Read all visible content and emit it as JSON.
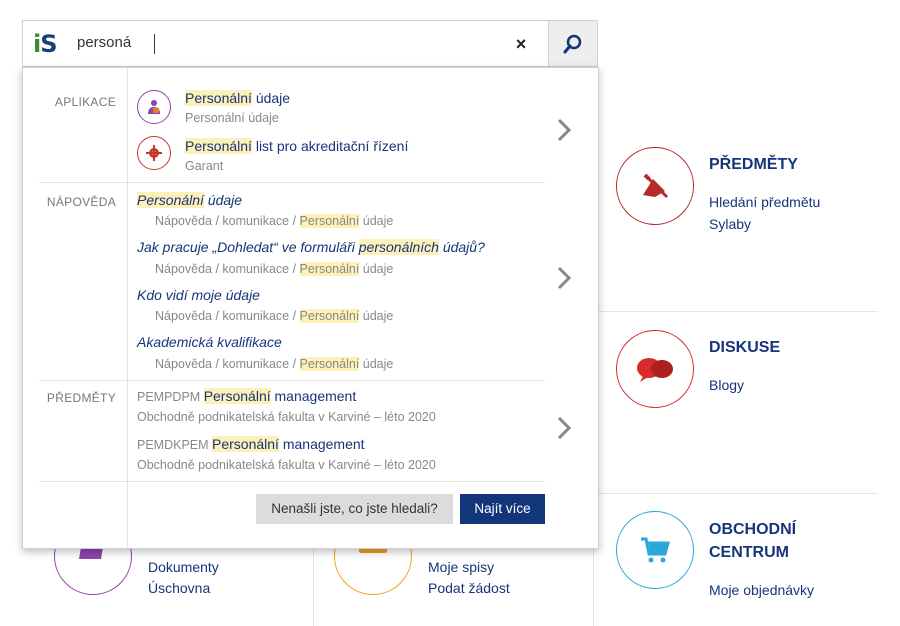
{
  "search": {
    "logo_i": "i",
    "logo_s": "S",
    "value": "personá",
    "clear_label": "×"
  },
  "highlight": "Personální",
  "dropdown": {
    "apps": {
      "label": "APLIKACE",
      "items": [
        {
          "icon": "person-icon",
          "color": "#8e44ad",
          "hl": "Personální",
          "rest": " údaje",
          "sub": "Personální údaje"
        },
        {
          "icon": "gear-icon",
          "color": "#c0392b",
          "hl": "Personální",
          "rest": " list pro akreditační řízení",
          "sub": "Garant"
        }
      ]
    },
    "help": {
      "label": "NÁPOVĚDA",
      "items": [
        {
          "title_pre": "",
          "title_hl": "Personální",
          "title_post": " údaje",
          "path_pre": "Nápověda / komunikace / ",
          "path_hl": "Personální",
          "path_post": " údaje"
        },
        {
          "title_pre": "Jak pracuje „Dohledat“ ve formuláři ",
          "title_hl": "personálních",
          "title_post": " údajů?",
          "path_pre": "Nápověda / komunikace / ",
          "path_hl": "Personální",
          "path_post": " údaje"
        },
        {
          "title_pre": "Kdo vidí moje údaje",
          "title_hl": "",
          "title_post": "",
          "path_pre": "Nápověda / komunikace / ",
          "path_hl": "Personální",
          "path_post": " údaje"
        },
        {
          "title_pre": "Akademická kvalifikace",
          "title_hl": "",
          "title_post": "",
          "path_pre": "Nápověda / komunikace / ",
          "path_hl": "Personální",
          "path_post": " údaje"
        }
      ]
    },
    "courses": {
      "label": "PŘEDMĚTY",
      "items": [
        {
          "code": "PEMPDPM ",
          "hl": "Personální",
          "rest": " management",
          "sub": "Obchodně podnikatelská fakulta v Karviné – léto 2020"
        },
        {
          "code": "PEMDKPEM ",
          "hl": "Personální",
          "rest": " management",
          "sub": "Obchodně podnikatelská fakulta v Karviné – léto 2020"
        }
      ]
    },
    "not_found_label": "Nenašli jste, co jste hledali?",
    "find_more_label": "Najít více"
  },
  "tiles": {
    "predmety": {
      "title": "PŘEDMĚTY",
      "links": [
        "Hledání předmětu",
        "Sylaby"
      ],
      "color": "#b52a2a"
    },
    "diskuse": {
      "title": "DISKUSE",
      "links": [
        "Blogy"
      ],
      "color": "#d62c2c"
    },
    "obchodni": {
      "title_1": "OBCHODNÍ",
      "title_2": "CENTRUM",
      "links": [
        "Moje objednávky"
      ],
      "color": "#2aa8d8"
    },
    "dokumenty": {
      "links": [
        "Dokumenty",
        "Úschovna"
      ],
      "color": "#8e44ad"
    },
    "spisy": {
      "links": [
        "Moje spisy",
        "Podat žádost"
      ],
      "color": "#f0a020"
    }
  }
}
